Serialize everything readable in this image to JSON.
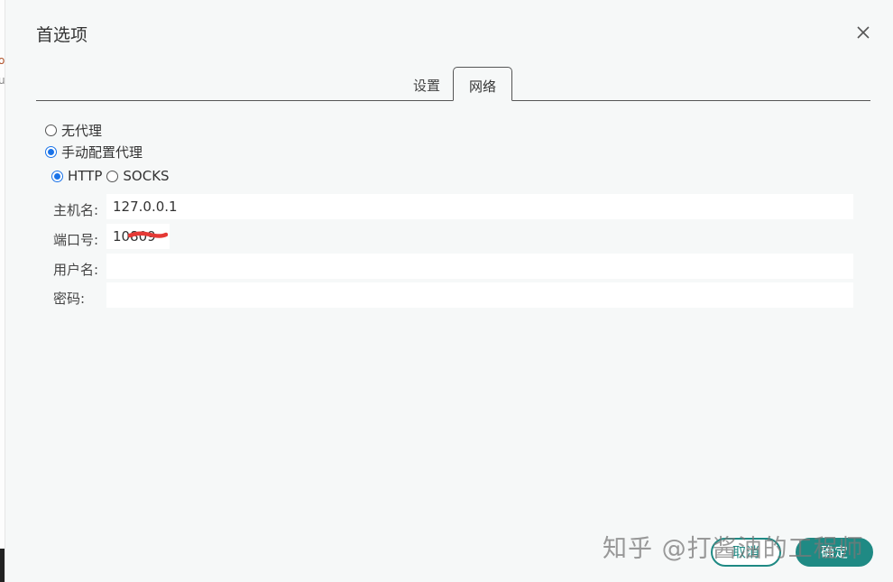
{
  "dialog": {
    "title": "首选项",
    "close_icon": "close-icon"
  },
  "tabs": [
    {
      "label": "设置",
      "active": false
    },
    {
      "label": "网络",
      "active": true
    }
  ],
  "proxy": {
    "no_proxy_label": "无代理",
    "manual_label": "手动配置代理",
    "selected": "manual",
    "types": [
      {
        "label": "HTTP",
        "checked": true
      },
      {
        "label": "SOCKS",
        "checked": false
      }
    ]
  },
  "fields": {
    "host": {
      "label": "主机名:",
      "value": "127.0.0.1"
    },
    "port": {
      "label": "端口号:",
      "value": "10809"
    },
    "username": {
      "label": "用户名:",
      "value": ""
    },
    "password": {
      "label": "密码:",
      "value": ""
    }
  },
  "buttons": {
    "cancel": "取消",
    "ok": "确定"
  },
  "watermark": "知乎 @打酱油的工程师",
  "colors": {
    "accent": "#1f8a84",
    "radio": "#1a73e8",
    "redaction": "#e53935"
  }
}
